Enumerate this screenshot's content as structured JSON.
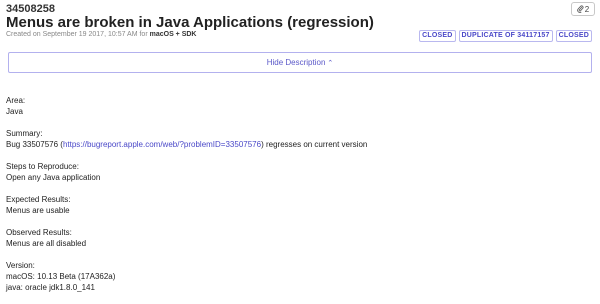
{
  "report": {
    "id": "34508258",
    "attachments_count": "2",
    "title": "Menus are broken in Java Applications (regression)",
    "meta_prefix": "Created on September 19 2017, 10:57 AM for",
    "product": "macOS + SDK",
    "tags": [
      "CLOSED",
      "DUPLICATE OF 34117157",
      "CLOSED"
    ]
  },
  "toggle": {
    "label": "Hide Description",
    "caret": "⌃"
  },
  "description": {
    "area_label": "Area:",
    "area_value": "Java",
    "summary_label": "Summary:",
    "summary_prefix": "Bug 33507576 (",
    "summary_link": "https://bugreport.apple.com/web/?problemID=33507576",
    "summary_suffix": ") regresses on current version",
    "steps_label": "Steps to Reproduce:",
    "steps_value": "Open any Java application",
    "expected_label": "Expected Results:",
    "expected_value": "Menus are usable",
    "observed_label": "Observed Results:",
    "observed_value": "Menus are all disabled",
    "version_label": "Version:",
    "version_line1": "macOS: 10.13 Beta (17A362a)",
    "version_line2": "java: oracle jdk1.8.0_141"
  }
}
